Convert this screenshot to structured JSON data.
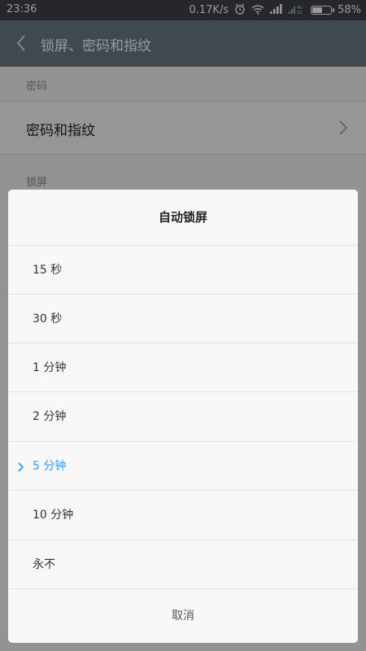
{
  "status_bar": {
    "time": "23:36",
    "speed": "0.17K/s",
    "icons": [
      "alarm-icon",
      "wifi-icon",
      "signal-icon",
      "signal-4g-icon",
      "battery-icon"
    ],
    "battery_percent": "58%",
    "battery_level": 0.58
  },
  "header": {
    "title": "锁屏、密码和指纹"
  },
  "page": {
    "section_password": "密码",
    "password_item": "密码和指纹",
    "section_lock": "锁屏"
  },
  "dialog": {
    "title": "自动锁屏",
    "options": [
      "15 秒",
      "30 秒",
      "1 分钟",
      "2 分钟",
      "5 分钟",
      "10 分钟",
      "永不"
    ],
    "selected_index": 4,
    "cancel": "取消"
  },
  "colors": {
    "accent": "#2a9df4",
    "titlebar": "#6d7a86",
    "statusbar": "#3e4246"
  }
}
